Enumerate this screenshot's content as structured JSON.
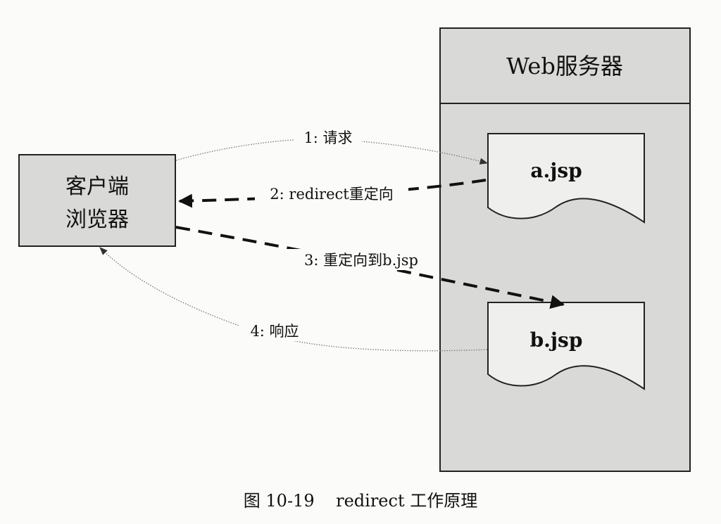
{
  "server": {
    "title": "Web服务器"
  },
  "client": {
    "line1": "客户端",
    "line2": "浏览器"
  },
  "pages": {
    "a": "a.jsp",
    "b": "b.jsp"
  },
  "steps": [
    {
      "label": "1: 请求",
      "style": "thin"
    },
    {
      "label": "2: redirect重定向",
      "style": "dashed"
    },
    {
      "label": "3: 重定向到b.jsp",
      "style": "dashed"
    },
    {
      "label": "4: 响应",
      "style": "thin"
    }
  ],
  "caption": "图 10-19    redirect 工作原理"
}
